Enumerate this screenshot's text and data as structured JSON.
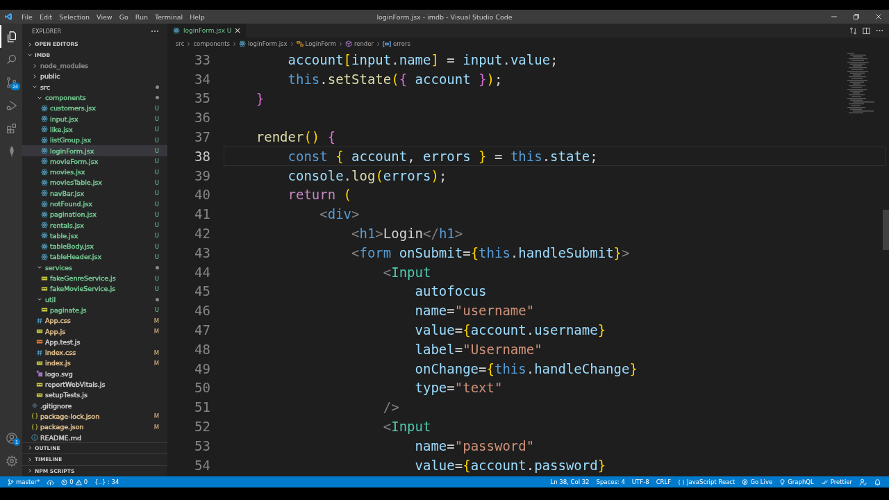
{
  "window": {
    "title": "loginForm.jsx - imdb - Visual Studio Code"
  },
  "menu": [
    "File",
    "Edit",
    "Selection",
    "View",
    "Go",
    "Run",
    "Terminal",
    "Help"
  ],
  "activity_bar": [
    {
      "kind": "explorer",
      "selected": true
    },
    {
      "kind": "search",
      "selected": false
    },
    {
      "kind": "source-control",
      "selected": false,
      "badge": "24"
    },
    {
      "kind": "run",
      "selected": false
    },
    {
      "kind": "extensions",
      "selected": false
    },
    {
      "kind": "leaf",
      "selected": false
    }
  ],
  "activity_bottom": [
    {
      "kind": "account",
      "badge": "1"
    },
    {
      "kind": "settings"
    }
  ],
  "sidebar": {
    "title": "EXPLORER",
    "open_editors": {
      "label": "OPEN EDITORS",
      "expanded": false
    },
    "project": {
      "label": "IMDB",
      "expanded": true,
      "tree": [
        {
          "name": "node_modules",
          "kind": "folder",
          "expanded": false,
          "selected": false,
          "color": "#8c8c8c"
        },
        {
          "name": "public",
          "kind": "folder",
          "expanded": false,
          "selected": false,
          "color": "#cccccc"
        },
        {
          "name": "src",
          "kind": "folder",
          "expanded": true,
          "selected": false,
          "color": "#cccccc",
          "dot": true,
          "children": [
            {
              "name": "components",
              "kind": "folder",
              "expanded": true,
              "selected": false,
              "color": "#73c991",
              "dot": true,
              "children": [
                {
                  "name": "customers.jsx",
                  "kind": "react",
                  "selected": false,
                  "color": "#73c991",
                  "badge": "U"
                },
                {
                  "name": "input.jsx",
                  "kind": "react",
                  "selected": false,
                  "color": "#73c991",
                  "badge": "U"
                },
                {
                  "name": "like.jsx",
                  "kind": "react",
                  "selected": false,
                  "color": "#73c991",
                  "badge": "U"
                },
                {
                  "name": "listGroup.jsx",
                  "kind": "react",
                  "selected": false,
                  "color": "#73c991",
                  "badge": "U"
                },
                {
                  "name": "loginForm.jsx",
                  "kind": "react",
                  "selected": true,
                  "color": "#73c991",
                  "badge": "U"
                },
                {
                  "name": "movieForm.jsx",
                  "kind": "react",
                  "selected": false,
                  "color": "#73c991",
                  "badge": "U"
                },
                {
                  "name": "movies.jsx",
                  "kind": "react",
                  "selected": false,
                  "color": "#73c991",
                  "badge": "U"
                },
                {
                  "name": "moviesTable.jsx",
                  "kind": "react",
                  "selected": false,
                  "color": "#73c991",
                  "badge": "U"
                },
                {
                  "name": "navBar.jsx",
                  "kind": "react",
                  "selected": false,
                  "color": "#73c991",
                  "badge": "U"
                },
                {
                  "name": "notFound.jsx",
                  "kind": "react",
                  "selected": false,
                  "color": "#73c991",
                  "badge": "U"
                },
                {
                  "name": "pagination.jsx",
                  "kind": "react",
                  "selected": false,
                  "color": "#73c991",
                  "badge": "U"
                },
                {
                  "name": "rentals.jsx",
                  "kind": "react",
                  "selected": false,
                  "color": "#73c991",
                  "badge": "U"
                },
                {
                  "name": "table.jsx",
                  "kind": "react",
                  "selected": false,
                  "color": "#73c991",
                  "badge": "U"
                },
                {
                  "name": "tableBody.jsx",
                  "kind": "react",
                  "selected": false,
                  "color": "#73c991",
                  "badge": "U"
                },
                {
                  "name": "tableHeader.jsx",
                  "kind": "react",
                  "selected": false,
                  "color": "#73c991",
                  "badge": "U"
                }
              ]
            },
            {
              "name": "services",
              "kind": "folder",
              "expanded": true,
              "selected": false,
              "color": "#73c991",
              "dot": true,
              "children": [
                {
                  "name": "fakeGenreService.js",
                  "kind": "js",
                  "selected": false,
                  "color": "#73c991",
                  "badge": "U"
                },
                {
                  "name": "fakeMovieService.js",
                  "kind": "js",
                  "selected": false,
                  "color": "#73c991",
                  "badge": "U"
                }
              ]
            },
            {
              "name": "util",
              "kind": "folder",
              "expanded": true,
              "selected": false,
              "color": "#73c991",
              "dot": true,
              "children": [
                {
                  "name": "paginate.js",
                  "kind": "js",
                  "selected": false,
                  "color": "#73c991",
                  "badge": "U"
                }
              ]
            },
            {
              "name": "App.css",
              "kind": "css",
              "selected": false,
              "color": "#e2c08d",
              "badge": "M"
            },
            {
              "name": "App.js",
              "kind": "js",
              "selected": false,
              "color": "#e2c08d",
              "badge": "M"
            },
            {
              "name": "App.test.js",
              "kind": "test",
              "selected": false,
              "color": "#cccccc"
            },
            {
              "name": "index.css",
              "kind": "css",
              "selected": false,
              "color": "#e2c08d",
              "badge": "M"
            },
            {
              "name": "index.js",
              "kind": "js",
              "selected": false,
              "color": "#e2c08d",
              "badge": "M"
            },
            {
              "name": "logo.svg",
              "kind": "svg",
              "selected": false,
              "color": "#cccccc"
            },
            {
              "name": "reportWebVitals.js",
              "kind": "js",
              "selected": false,
              "color": "#cccccc"
            },
            {
              "name": "setupTests.js",
              "kind": "js",
              "selected": false,
              "color": "#cccccc"
            }
          ]
        },
        {
          "name": ".gitignore",
          "kind": "git",
          "selected": false,
          "color": "#cccccc"
        },
        {
          "name": "package-lock.json",
          "kind": "json",
          "selected": false,
          "color": "#e2c08d",
          "badge": "M"
        },
        {
          "name": "package.json",
          "kind": "json",
          "selected": false,
          "color": "#e2c08d",
          "badge": "M"
        },
        {
          "name": "README.md",
          "kind": "info",
          "selected": false,
          "color": "#cccccc"
        }
      ]
    },
    "panels": [
      {
        "label": "OUTLINE",
        "expanded": false
      },
      {
        "label": "TIMELINE",
        "expanded": false
      },
      {
        "label": "NPM SCRIPTS",
        "expanded": false
      }
    ]
  },
  "editor": {
    "tabs": [
      {
        "label": "loginForm.jsx",
        "badge": "U",
        "selected": true
      }
    ],
    "breadcrumbs": [
      {
        "kind": "folder",
        "label": "src"
      },
      {
        "kind": "folder",
        "label": "components"
      },
      {
        "kind": "react",
        "label": "loginForm.jsx"
      },
      {
        "kind": "class",
        "label": "LoginForm"
      },
      {
        "kind": "method",
        "label": "render"
      },
      {
        "kind": "variable",
        "label": "errors"
      }
    ],
    "lines": [
      {
        "n": "33",
        "current": false,
        "tokens": [
          {
            "kind": "v",
            "text": "        account"
          },
          {
            "kind": "g",
            "text": "["
          },
          {
            "kind": "v",
            "text": "input"
          },
          {
            "kind": "p",
            "text": "."
          },
          {
            "kind": "v",
            "text": "name"
          },
          {
            "kind": "g",
            "text": "]"
          },
          {
            "kind": "p",
            "text": " = "
          },
          {
            "kind": "v",
            "text": "input"
          },
          {
            "kind": "p",
            "text": "."
          },
          {
            "kind": "v",
            "text": "value"
          },
          {
            "kind": "p",
            "text": ";"
          }
        ]
      },
      {
        "n": "34",
        "current": false,
        "tokens": [
          {
            "kind": "kw",
            "text": "        this"
          },
          {
            "kind": "p",
            "text": "."
          },
          {
            "kind": "fn",
            "text": "setState"
          },
          {
            "kind": "g",
            "text": "("
          },
          {
            "kind": "m",
            "text": "{"
          },
          {
            "kind": "v",
            "text": " account "
          },
          {
            "kind": "m",
            "text": "}"
          },
          {
            "kind": "g",
            "text": ")"
          },
          {
            "kind": "p",
            "text": ";"
          }
        ]
      },
      {
        "n": "35",
        "current": false,
        "tokens": [
          {
            "kind": "m",
            "text": "    }"
          }
        ]
      },
      {
        "n": "36",
        "current": false
      },
      {
        "n": "37",
        "current": false,
        "tokens": [
          {
            "kind": "fn",
            "text": "    render"
          },
          {
            "kind": "g",
            "text": "()"
          },
          {
            "kind": "m",
            "text": " {"
          }
        ]
      },
      {
        "n": "38",
        "current": true,
        "tokens": [
          {
            "kind": "kw",
            "text": "        const"
          },
          {
            "kind": "g",
            "text": " {"
          },
          {
            "kind": "v",
            "text": " account"
          },
          {
            "kind": "p",
            "text": ", "
          },
          {
            "kind": "v",
            "text": "errors "
          },
          {
            "kind": "g",
            "text": "}"
          },
          {
            "kind": "p",
            "text": " = "
          },
          {
            "kind": "kw",
            "text": "this"
          },
          {
            "kind": "p",
            "text": "."
          },
          {
            "kind": "v",
            "text": "state"
          },
          {
            "kind": "p",
            "text": ";"
          }
        ]
      },
      {
        "n": "39",
        "current": false,
        "tokens": [
          {
            "kind": "v",
            "text": "        console"
          },
          {
            "kind": "p",
            "text": "."
          },
          {
            "kind": "fn",
            "text": "log"
          },
          {
            "kind": "g",
            "text": "("
          },
          {
            "kind": "v",
            "text": "errors"
          },
          {
            "kind": "g",
            "text": ")"
          },
          {
            "kind": "p",
            "text": ";"
          }
        ]
      },
      {
        "n": "40",
        "current": false,
        "tokens": [
          {
            "kind": "ctl",
            "text": "        return"
          },
          {
            "kind": "g",
            "text": " ("
          }
        ]
      },
      {
        "n": "41",
        "current": false,
        "tokens": [
          {
            "kind": "t",
            "text": "            <"
          },
          {
            "kind": "kw",
            "text": "div"
          },
          {
            "kind": "t",
            "text": ">"
          }
        ]
      },
      {
        "n": "42",
        "current": false,
        "tokens": [
          {
            "kind": "t",
            "text": "                <"
          },
          {
            "kind": "kw",
            "text": "h1"
          },
          {
            "kind": "t",
            "text": ">"
          },
          {
            "kind": "p",
            "text": "Login"
          },
          {
            "kind": "t",
            "text": "</"
          },
          {
            "kind": "kw",
            "text": "h1"
          },
          {
            "kind": "t",
            "text": ">"
          }
        ]
      },
      {
        "n": "43",
        "current": false,
        "tokens": [
          {
            "kind": "t",
            "text": "                <"
          },
          {
            "kind": "kw",
            "text": "form"
          },
          {
            "kind": "v",
            "text": " onSubmit"
          },
          {
            "kind": "p",
            "text": "="
          },
          {
            "kind": "g",
            "text": "{"
          },
          {
            "kind": "kw",
            "text": "this"
          },
          {
            "kind": "p",
            "text": "."
          },
          {
            "kind": "v",
            "text": "handleSubmit"
          },
          {
            "kind": "g",
            "text": "}"
          },
          {
            "kind": "t",
            "text": ">"
          }
        ]
      },
      {
        "n": "44",
        "current": false,
        "tokens": [
          {
            "kind": "t",
            "text": "                    <"
          },
          {
            "kind": "c",
            "text": "Input"
          }
        ]
      },
      {
        "n": "45",
        "current": false,
        "tokens": [
          {
            "kind": "v",
            "text": "                        autofocus"
          }
        ]
      },
      {
        "n": "46",
        "current": false,
        "tokens": [
          {
            "kind": "v",
            "text": "                        name"
          },
          {
            "kind": "p",
            "text": "="
          },
          {
            "kind": "s",
            "text": "\"username\""
          }
        ]
      },
      {
        "n": "47",
        "current": false,
        "tokens": [
          {
            "kind": "v",
            "text": "                        value"
          },
          {
            "kind": "p",
            "text": "="
          },
          {
            "kind": "g",
            "text": "{"
          },
          {
            "kind": "v",
            "text": "account"
          },
          {
            "kind": "p",
            "text": "."
          },
          {
            "kind": "v",
            "text": "username"
          },
          {
            "kind": "g",
            "text": "}"
          }
        ]
      },
      {
        "n": "48",
        "current": false,
        "tokens": [
          {
            "kind": "v",
            "text": "                        label"
          },
          {
            "kind": "p",
            "text": "="
          },
          {
            "kind": "s",
            "text": "\"Username\""
          }
        ]
      },
      {
        "n": "49",
        "current": false,
        "tokens": [
          {
            "kind": "v",
            "text": "                        onChange"
          },
          {
            "kind": "p",
            "text": "="
          },
          {
            "kind": "g",
            "text": "{"
          },
          {
            "kind": "kw",
            "text": "this"
          },
          {
            "kind": "p",
            "text": "."
          },
          {
            "kind": "v",
            "text": "handleChange"
          },
          {
            "kind": "g",
            "text": "}"
          }
        ]
      },
      {
        "n": "50",
        "current": false,
        "tokens": [
          {
            "kind": "v",
            "text": "                        type"
          },
          {
            "kind": "p",
            "text": "="
          },
          {
            "kind": "s",
            "text": "\"text\""
          }
        ]
      },
      {
        "n": "51",
        "current": false,
        "tokens": [
          {
            "kind": "t",
            "text": "                    />"
          }
        ]
      },
      {
        "n": "52",
        "current": false,
        "tokens": [
          {
            "kind": "t",
            "text": "                    <"
          },
          {
            "kind": "c",
            "text": "Input"
          }
        ]
      },
      {
        "n": "53",
        "current": false,
        "tokens": [
          {
            "kind": "v",
            "text": "                        name"
          },
          {
            "kind": "p",
            "text": "="
          },
          {
            "kind": "s",
            "text": "\"password\""
          }
        ]
      },
      {
        "n": "54",
        "current": false,
        "tokens": [
          {
            "kind": "v",
            "text": "                        value"
          },
          {
            "kind": "p",
            "text": "="
          },
          {
            "kind": "g",
            "text": "{"
          },
          {
            "kind": "v",
            "text": "account"
          },
          {
            "kind": "p",
            "text": "."
          },
          {
            "kind": "v",
            "text": "password"
          },
          {
            "kind": "g",
            "text": "}"
          }
        ]
      }
    ]
  },
  "status_bar": {
    "left": [
      {
        "kind": "branch",
        "text": "master*"
      },
      {
        "kind": "sync"
      },
      {
        "kind": "problems",
        "errors": "0",
        "warnings": "0"
      },
      {
        "kind": "plain",
        "text": "{..} : 34"
      }
    ],
    "right": [
      {
        "kind": "plain",
        "text": "Ln 38, Col 32"
      },
      {
        "kind": "plain",
        "text": "Spaces: 4"
      },
      {
        "kind": "plain",
        "text": "UTF-8"
      },
      {
        "kind": "plain",
        "text": "CRLF"
      },
      {
        "kind": "language",
        "text": "JavaScript React"
      },
      {
        "kind": "golive",
        "text": "Go Live"
      },
      {
        "kind": "graphql",
        "text": "GraphQL"
      },
      {
        "kind": "prettier",
        "text": "Prettier"
      },
      {
        "kind": "feedback"
      },
      {
        "kind": "bell"
      }
    ]
  }
}
